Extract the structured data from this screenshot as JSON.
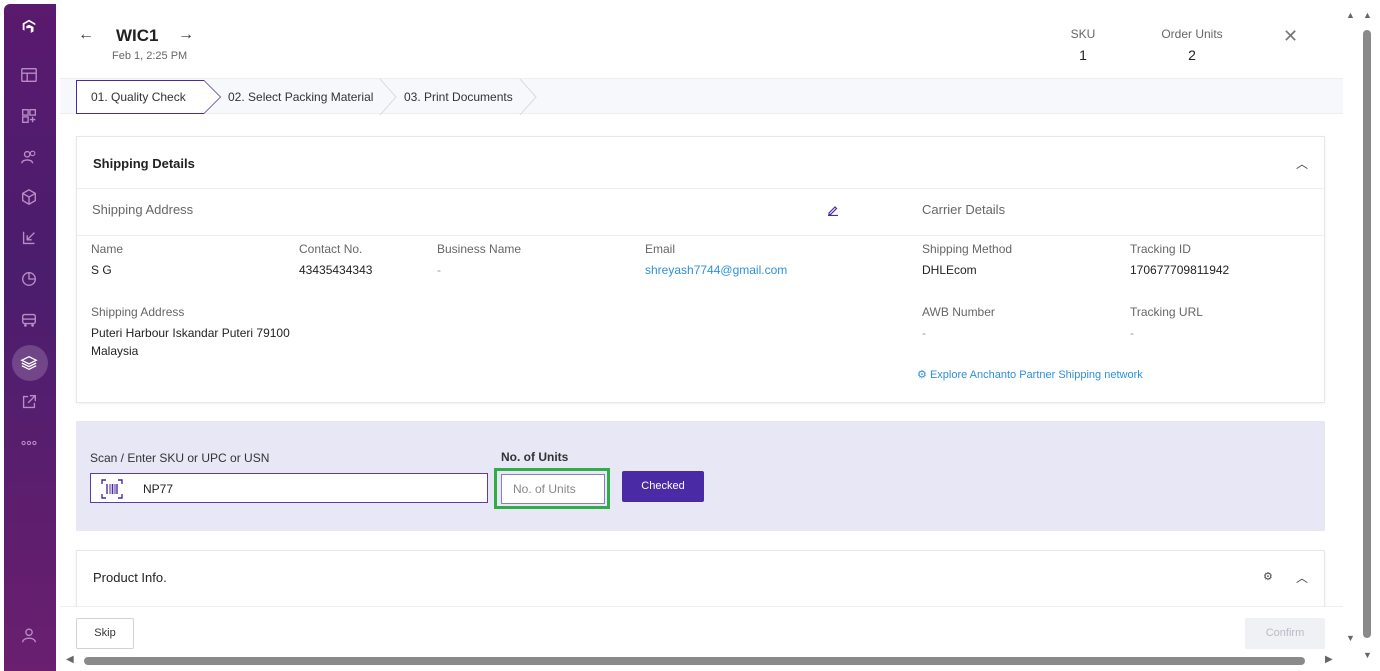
{
  "header": {
    "title": "WIC1",
    "date": "Feb 1, 2:25 PM",
    "sku_label": "SKU",
    "sku_value": "1",
    "order_units_label": "Order Units",
    "order_units_value": "2"
  },
  "steps": [
    {
      "label": "01. Quality Check",
      "active": true
    },
    {
      "label": "02. Select Packing Material",
      "active": false
    },
    {
      "label": "03. Print Documents",
      "active": false
    }
  ],
  "shipping": {
    "title": "Shipping Details",
    "address_section": "Shipping Address",
    "carrier_section": "Carrier Details",
    "name_label": "Name",
    "name_value": "S G",
    "contact_label": "Contact No.",
    "contact_value": "43435434343",
    "business_label": "Business Name",
    "business_value": "-",
    "email_label": "Email",
    "email_value": "shreyash7744@gmail.com",
    "address_label": "Shipping Address",
    "address_line1": "Puteri Harbour Iskandar Puteri 79100",
    "address_line2": "Malaysia",
    "method_label": "Shipping Method",
    "method_value": "DHLEcom",
    "tracking_id_label": "Tracking ID",
    "tracking_id_value": "170677709811942",
    "awb_label": "AWB Number",
    "awb_value": "-",
    "tracking_url_label": "Tracking URL",
    "tracking_url_value": "-",
    "explore_link": "Explore Anchanto Partner Shipping network"
  },
  "scan": {
    "sku_label": "Scan / Enter SKU or UPC or USN",
    "sku_value": "NP77",
    "units_label": "No. of Units",
    "units_placeholder": "No. of Units",
    "checked_button": "Checked"
  },
  "product": {
    "title": "Product Info."
  },
  "footer": {
    "skip": "Skip",
    "confirm": "Confirm"
  },
  "colors": {
    "accent": "#4b2aa5",
    "highlight": "#2fae45",
    "link": "#2f8fd8",
    "sidebar": "#5a1a6e"
  }
}
